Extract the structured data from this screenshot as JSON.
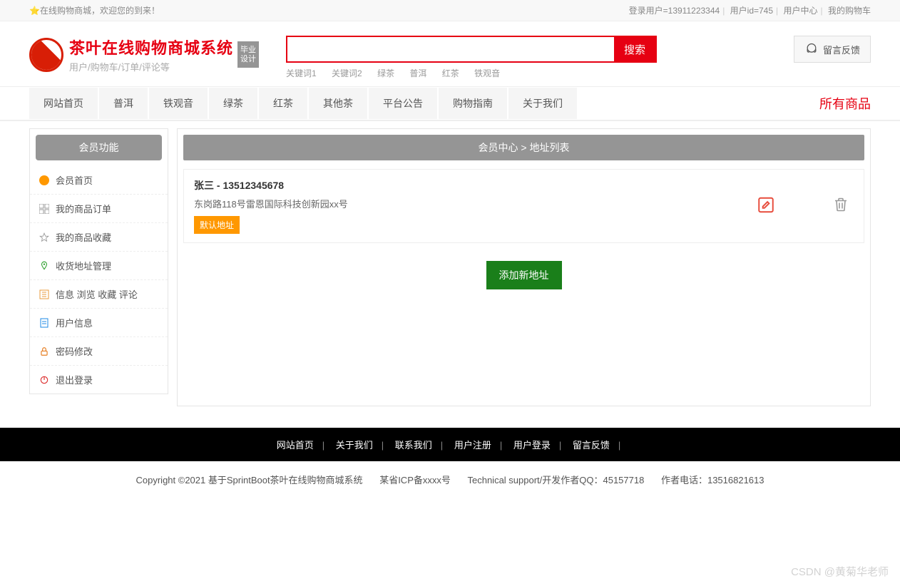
{
  "topbar": {
    "welcome": "在线购物商城，欢迎您的到来！",
    "login_user": "登录用户=13911223344",
    "user_id": "用户id=745",
    "user_center": "用户中心",
    "my_cart": "我的购物车"
  },
  "header": {
    "title": "茶叶在线购物商城系统",
    "subtitle": "用户/购物车/订单/评论等",
    "badge_l1": "毕业",
    "badge_l2": "设计",
    "search_btn": "搜索",
    "search_placeholder": "",
    "keywords": [
      "关键词1",
      "关键词2",
      "绿茶",
      "普洱",
      "红茶",
      "铁观音"
    ],
    "feedback": "留言反馈"
  },
  "nav": {
    "items": [
      "网站首页",
      "普洱",
      "铁观音",
      "绿茶",
      "红茶",
      "其他茶",
      "平台公告",
      "购物指南",
      "关于我们"
    ],
    "all_goods": "所有商品"
  },
  "sidebar": {
    "title": "会员功能",
    "items": [
      {
        "label": "会员首页"
      },
      {
        "label": "我的商品订单"
      },
      {
        "label": "我的商品收藏"
      },
      {
        "label": "收货地址管理"
      },
      {
        "label": "信息 浏览 收藏 评论"
      },
      {
        "label": "用户信息"
      },
      {
        "label": "密码修改"
      },
      {
        "label": "退出登录"
      }
    ]
  },
  "content": {
    "crumb": "会员中心 > 地址列表",
    "addr_name": "张三 - 13512345678",
    "addr_detail": "东岗路118号雷恩国际科技创新园xx号",
    "default_tag": "默认地址",
    "add_btn": "添加新地址"
  },
  "footer": {
    "links": [
      "网站首页",
      "关于我们",
      "联系我们",
      "用户注册",
      "用户登录",
      "留言反馈"
    ],
    "copy_a": "Copyright ©2021 基于SprintBoot茶叶在线购物商城系统",
    "copy_b": "某省ICP备xxxx号",
    "copy_c": "Technical support/开发作者QQ：45157718",
    "copy_d": "作者电话：13516821613"
  },
  "watermark": "CSDN @黄菊华老师"
}
